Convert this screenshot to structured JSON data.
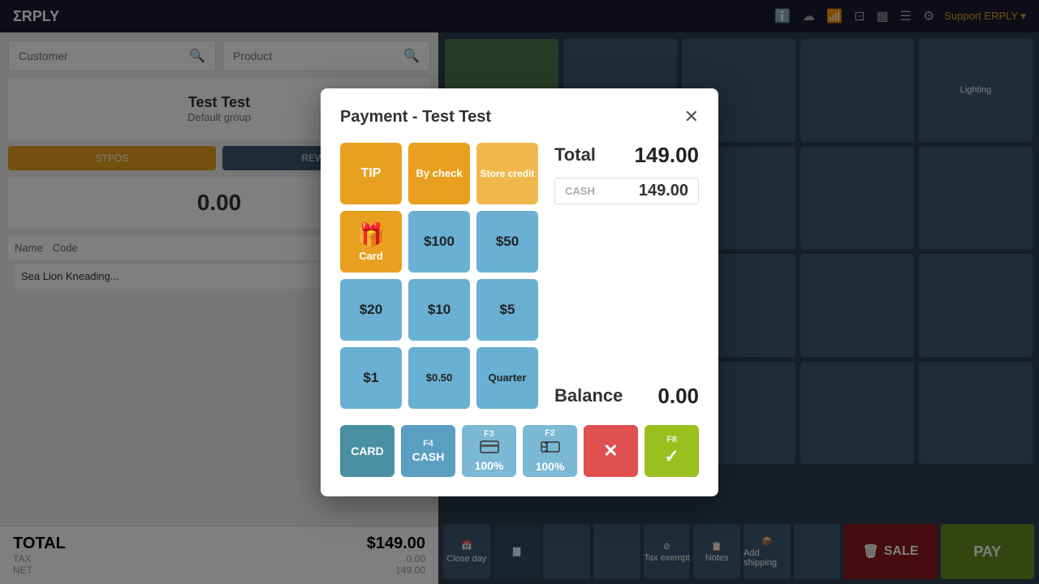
{
  "app": {
    "logo": "ΣRPLY",
    "support_label": "Support ERPLY ▾"
  },
  "topbar": {
    "icons": [
      "ℹ",
      "☁",
      "📶",
      "⊡",
      "≡≡",
      "☰",
      "⚙"
    ]
  },
  "background": {
    "customer_placeholder": "Customer",
    "product_placeholder": "Product",
    "customer_name": "Test Test",
    "customer_group": "Default group",
    "total_label": "TOTAL",
    "total_value": "$149.00",
    "tax_label": "TAX",
    "tax_value": "0.00",
    "net_label": "NET",
    "net_value": "149.00",
    "item_name": "Sea Lion Kneading...",
    "col_name": "Name",
    "col_code": "Code",
    "stpos_label": "STPOS",
    "rewards_label": "REWARDS",
    "amount_label": "0.00",
    "cat_buttons": [
      "Lighting",
      "..."
    ],
    "action_buttons": [
      "SALE",
      "PAY",
      "F2"
    ]
  },
  "modal": {
    "title": "Payment - Test Test",
    "close_icon": "✕",
    "total_label": "Total",
    "total_value": "149.00",
    "cash_placeholder": "CASH",
    "cash_value": "149.00",
    "balance_label": "Balance",
    "balance_value": "0.00",
    "payment_methods": [
      {
        "id": "tip",
        "label": "TIP",
        "color": "yellow"
      },
      {
        "id": "by_check",
        "label": "By check",
        "color": "yellow"
      },
      {
        "id": "store_credit",
        "label": "Store credit",
        "color": "yellow-light"
      },
      {
        "id": "gift_card",
        "label": "Card",
        "color": "gift-card",
        "is_gift": true
      },
      {
        "id": "100",
        "label": "$100",
        "color": "blue-light"
      },
      {
        "id": "50",
        "label": "$50",
        "color": "blue-light"
      },
      {
        "id": "20",
        "label": "$20",
        "color": "blue-light"
      },
      {
        "id": "10",
        "label": "$10",
        "color": "blue-light"
      },
      {
        "id": "5",
        "label": "$5",
        "color": "blue-light"
      },
      {
        "id": "1",
        "label": "$1",
        "color": "blue-light"
      },
      {
        "id": "0.50",
        "label": "$0.50",
        "color": "blue-light"
      },
      {
        "id": "quarter",
        "label": "Quarter",
        "color": "blue-light"
      }
    ],
    "action_buttons": [
      {
        "id": "card",
        "label": "CARD",
        "fn": "",
        "color": "teal"
      },
      {
        "id": "cash",
        "label": "CASH",
        "fn": "F4",
        "color": "blue-med"
      },
      {
        "id": "credit_card_100",
        "label": "100%",
        "fn": "F3",
        "color": "blue-light-2",
        "has_icon": true,
        "icon": "💳"
      },
      {
        "id": "gift_100",
        "label": "100%",
        "fn": "F2",
        "color": "blue-light-2",
        "has_icon": true,
        "icon": "🎫"
      },
      {
        "id": "cancel",
        "label": "✕",
        "fn": "",
        "color": "red"
      },
      {
        "id": "confirm",
        "label": "✓",
        "fn": "F8",
        "color": "green-yellow"
      }
    ]
  }
}
